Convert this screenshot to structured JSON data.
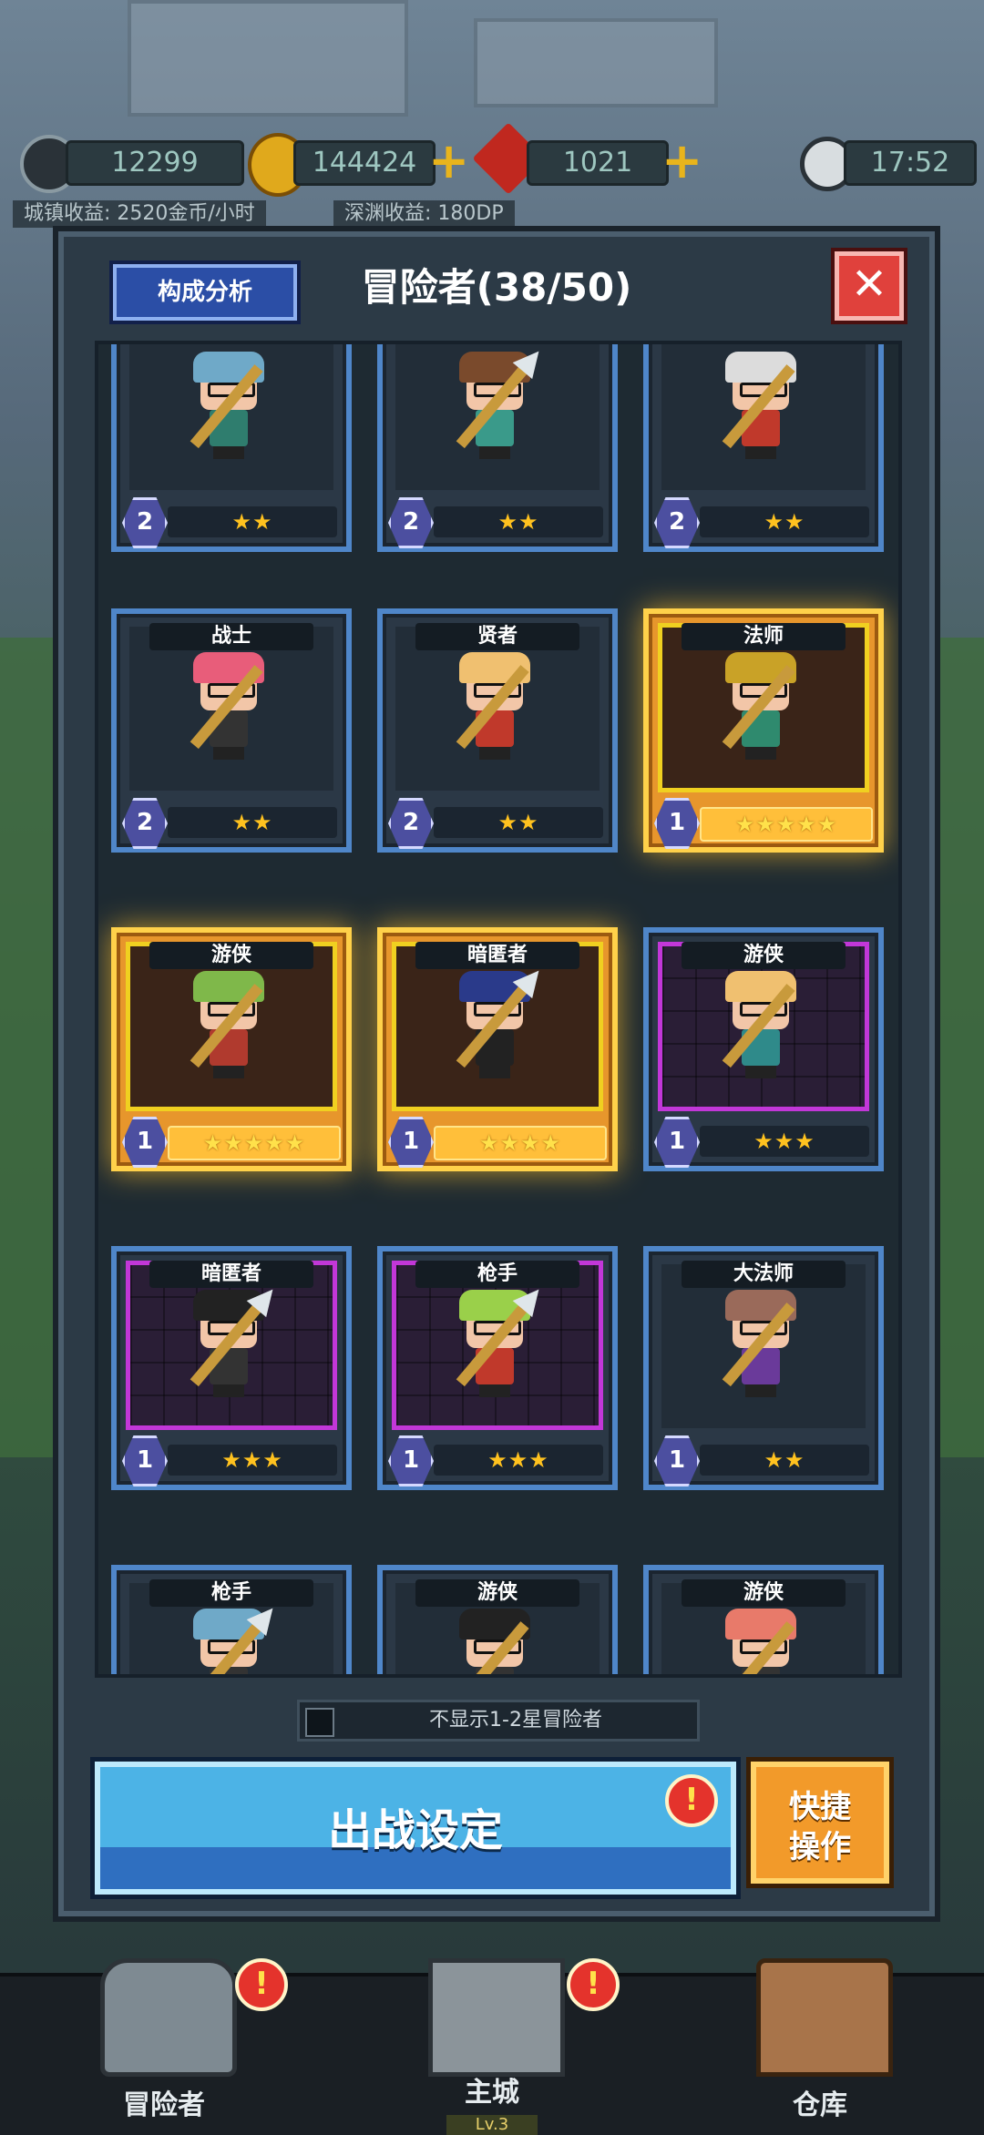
{
  "hud": {
    "resources": [
      {
        "name": "moon-resource",
        "value": "12299"
      },
      {
        "name": "gold-resource",
        "value": "144424"
      },
      {
        "name": "gem-resource",
        "value": "1021"
      }
    ],
    "time": "17:52",
    "town_income": "城镇收益: 2520金币/小时",
    "abyss_income": "深渊收益: 180DP"
  },
  "panel": {
    "analysis_label": "构成分析",
    "title": "冒险者(38/50)",
    "close_label": "✕"
  },
  "adventurers": [
    {
      "class": "",
      "level": "2",
      "stars": "★★",
      "rarity": "blue",
      "hair": "#6fa9c8",
      "outfit": "#2f7d6e",
      "weapon": "bow"
    },
    {
      "class": "",
      "level": "2",
      "stars": "★★",
      "rarity": "blue",
      "hair": "#7a4a2c",
      "outfit": "#3a9a8a",
      "weapon": "spear"
    },
    {
      "class": "",
      "level": "2",
      "stars": "★★",
      "rarity": "blue",
      "hair": "#dcdcdc",
      "outfit": "#c0392b",
      "weapon": "staff"
    },
    {
      "class": "战士",
      "level": "2",
      "stars": "★★",
      "rarity": "blue",
      "hair": "#e85d7a",
      "outfit": "#333",
      "weapon": "sword"
    },
    {
      "class": "贤者",
      "level": "2",
      "stars": "★★",
      "rarity": "blue",
      "hair": "#f0c070",
      "outfit": "#c0392b",
      "weapon": "hammer"
    },
    {
      "class": "法师",
      "level": "1",
      "stars": "★★★★★",
      "rarity": "gold",
      "hair": "#c9a227",
      "outfit": "#2f8a6e",
      "weapon": "staff"
    },
    {
      "class": "游侠",
      "level": "1",
      "stars": "★★★★★",
      "rarity": "gold",
      "hair": "#7fb84a",
      "outfit": "#b03a2e",
      "weapon": "bow"
    },
    {
      "class": "暗匿者",
      "level": "1",
      "stars": "★★★★",
      "rarity": "gold",
      "hair": "#2a3a8a",
      "outfit": "#222",
      "weapon": "spear"
    },
    {
      "class": "游侠",
      "level": "1",
      "stars": "★★★",
      "rarity": "purple",
      "hair": "#f0c070",
      "outfit": "#2f8a8a",
      "weapon": "bow"
    },
    {
      "class": "暗匿者",
      "level": "1",
      "stars": "★★★",
      "rarity": "purple",
      "hair": "#222",
      "outfit": "#333",
      "weapon": "spear"
    },
    {
      "class": "枪手",
      "level": "1",
      "stars": "★★★",
      "rarity": "purple",
      "hair": "#9ad04a",
      "outfit": "#c0392b",
      "weapon": "spear"
    },
    {
      "class": "大法师",
      "level": "1",
      "stars": "★★",
      "rarity": "blue",
      "hair": "#9a6a5a",
      "outfit": "#6a3a9a",
      "weapon": "staff"
    },
    {
      "class": "枪手",
      "level": "",
      "stars": "",
      "rarity": "blue",
      "hair": "#6fa9c8",
      "outfit": "#333",
      "weapon": "spear"
    },
    {
      "class": "游侠",
      "level": "",
      "stars": "",
      "rarity": "blue",
      "hair": "#222",
      "outfit": "#333",
      "weapon": "bow"
    },
    {
      "class": "游侠",
      "level": "",
      "stars": "",
      "rarity": "blue",
      "hair": "#e87a6a",
      "outfit": "#333",
      "weapon": "bow"
    }
  ],
  "filter_label": "不显示1-2星冒险者",
  "deploy_label": "出战设定",
  "quick_label_line1": "快捷",
  "quick_label_line2": "操作",
  "alert_mark": "!",
  "nav": {
    "adventurers_label": "冒险者",
    "castle_label": "主城",
    "castle_level": "Lv.3",
    "warehouse_label": "仓库"
  },
  "colors": {
    "accent_blue": "#4f86c9",
    "gold": "#ffd14a",
    "danger": "#e0413c"
  }
}
